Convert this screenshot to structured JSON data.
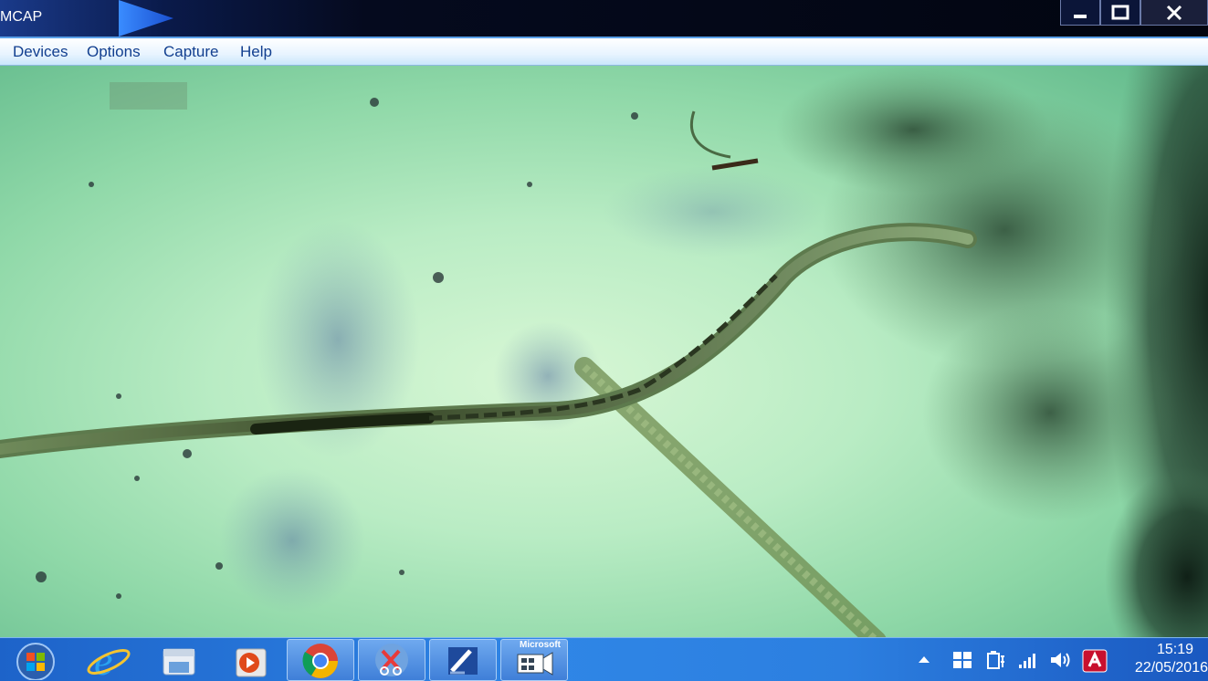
{
  "window": {
    "title": "MCAP"
  },
  "menu": {
    "items": [
      "Devices",
      "Options",
      "Capture",
      "Help"
    ]
  },
  "taskbar": {
    "apps": [
      {
        "name": "start-orb"
      },
      {
        "name": "internet-explorer-icon"
      },
      {
        "name": "file-explorer-icon"
      },
      {
        "name": "media-player-icon"
      },
      {
        "name": "chrome-icon"
      },
      {
        "name": "snipping-tool-icon"
      },
      {
        "name": "app-icon"
      },
      {
        "name": "microsoft-camera-app-icon"
      }
    ],
    "camera_app_label": "Microsoft",
    "clock": {
      "time": "15:19",
      "date": "22/05/2016"
    }
  },
  "colors": {
    "taskbar": "#2f86e6",
    "menu_text": "#123f8f",
    "video_bg": "#b9ecc4"
  }
}
